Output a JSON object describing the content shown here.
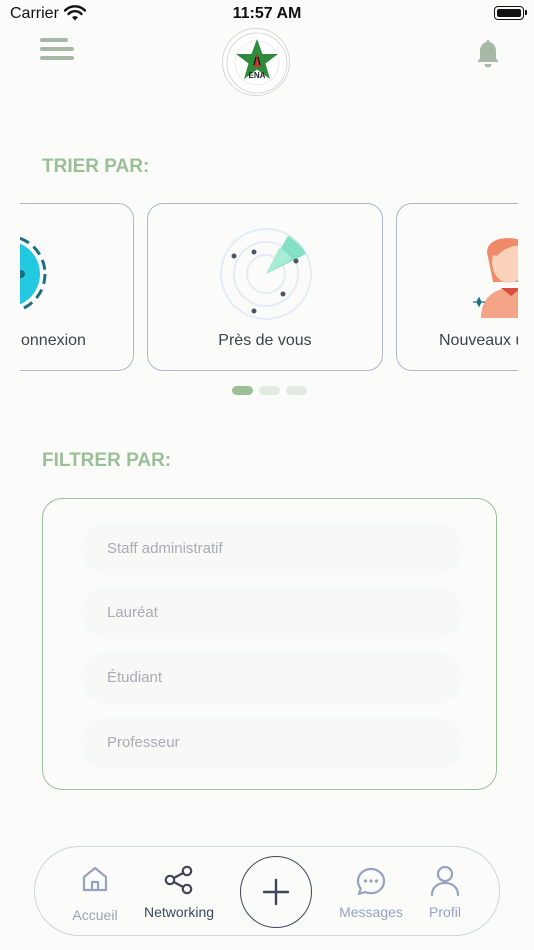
{
  "status_bar": {
    "carrier": "Carrier",
    "time": "11:57 AM"
  },
  "header": {
    "logo_text": "ENA"
  },
  "sort": {
    "title": "TRIER PAR:",
    "cards": [
      {
        "label": "onnexion"
      },
      {
        "label": "Près de vous"
      },
      {
        "label": "Nouveaux u"
      }
    ],
    "active_page": 0,
    "page_count": 3
  },
  "filter": {
    "title": "FILTRER PAR:",
    "items": [
      {
        "label": "Staff administratif"
      },
      {
        "label": "Lauréat"
      },
      {
        "label": "Étudiant"
      },
      {
        "label": "Professeur"
      }
    ]
  },
  "nav": {
    "items": [
      {
        "label": "Accueil",
        "active": false
      },
      {
        "label": "Networking",
        "active": true
      },
      {
        "label": "Messages",
        "active": false
      },
      {
        "label": "Profil",
        "active": false
      }
    ]
  },
  "colors": {
    "accent_green": "#9bbf97",
    "card_border": "#aeb6cc",
    "text_dark": "#3c4350",
    "nav_inactive": "#96a3bd",
    "radar_green": "#6fdcb8",
    "connexion_cyan": "#22c9e0"
  }
}
